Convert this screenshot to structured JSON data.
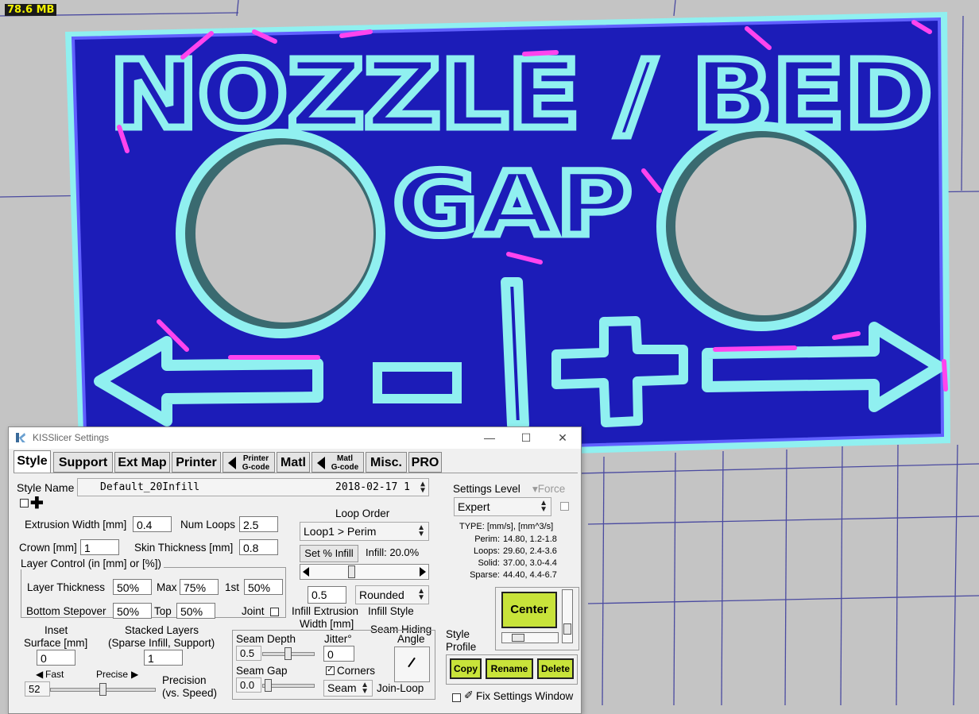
{
  "memory": "78.6 MB",
  "model_text": {
    "line1": "NOZZLE / BED",
    "line2": "GAP",
    "minus": "-",
    "plus": "+"
  },
  "window": {
    "title": "KISSlicer Settings",
    "minimize": "—",
    "maximize": "☐",
    "close": "✕"
  },
  "tabs": [
    {
      "label": "Style"
    },
    {
      "label": "Support"
    },
    {
      "label": "Ext Map"
    },
    {
      "label": "Printer"
    },
    {
      "l1": "Printer",
      "l2": "G-code"
    },
    {
      "label": "Matl"
    },
    {
      "l1": "Matl",
      "l2": "G-code"
    },
    {
      "label": "Misc."
    },
    {
      "label": "PRO"
    }
  ],
  "style": {
    "name_label": "Style Name",
    "name_value": "Default_20Infill",
    "name_date": "2018-02-17 1",
    "extrusion_width_label": "Extrusion Width [mm]",
    "extrusion_width": "0.4",
    "num_loops_label": "Num Loops",
    "num_loops": "2.5",
    "crown_label": "Crown [mm]",
    "crown": "1",
    "skin_label": "Skin Thickness [mm]",
    "skin": "0.8",
    "loop_order_label": "Loop Order",
    "loop_order": "Loop1 > Perim",
    "set_infill": "Set % Infill",
    "infill_pct_label": "Infill: 20.0%",
    "layer_control_label": "Layer Control (in [mm] or [%])",
    "layer_thickness_label": "Layer Thickness",
    "layer_thickness": "50%",
    "max_label": "Max",
    "max": "75%",
    "first_label": "1st",
    "first": "50%",
    "bottom_stepover_label": "Bottom Stepover",
    "bottom_stepover": "50%",
    "top_label": "Top",
    "top": "50%",
    "joint_label": "Joint",
    "infill_width": "0.5",
    "infill_style": "Rounded",
    "infill_width_label1": "Infill Extrusion",
    "infill_width_label2": "Width [mm]",
    "infill_style_label": "Infill Style",
    "seam_hiding_label": "Seam Hiding",
    "inset_label1": "Inset",
    "inset_label2": "Surface [mm]",
    "inset": "0",
    "stacked_label1": "Stacked Layers",
    "stacked_label2": "(Sparse Infill, Support)",
    "stacked": "1",
    "fast_label": "Fast",
    "precise_label": "Precise",
    "precision_value": "52",
    "precision_label1": "Precision",
    "precision_label2": "(vs. Speed)",
    "seam_depth_label": "Seam Depth",
    "seam_depth": "0.5",
    "jitter_label": "Jitter°",
    "jitter": "0",
    "angle_label": "Angle",
    "seam_gap_label": "Seam Gap",
    "seam_gap": "0.0",
    "corners_label": "Corners",
    "seam_select": "Seam",
    "join_loop_label": "Join-Loop"
  },
  "settings": {
    "level_label": "Settings Level",
    "force_label": "Force",
    "level": "Expert",
    "type_header": "TYPE: [mm/s], [mm^3/s]",
    "rows": [
      {
        "name": "Perim:",
        "value": "14.80,  1.2-1.8"
      },
      {
        "name": "Loops:",
        "value": "29.60,  2.4-3.6"
      },
      {
        "name": "Solid:",
        "value": "37.00,  3.0-4.4"
      },
      {
        "name": "Sparse:",
        "value": "44.40,  4.4-6.7"
      }
    ],
    "center": "Center",
    "style_profile_label1": "Style",
    "style_profile_label2": "Profile",
    "copy": "Copy",
    "rename": "Rename",
    "delete": "Delete",
    "fix_window": "Fix Settings Window"
  },
  "colors": {
    "background": "#c4c4c4",
    "grid": "#4a4aa0",
    "plate": "#1c1cb8",
    "outline": "#90f0f0",
    "accent": "#ff44ee",
    "wall": "#3a6a70",
    "button_green": "#c8e33a"
  }
}
